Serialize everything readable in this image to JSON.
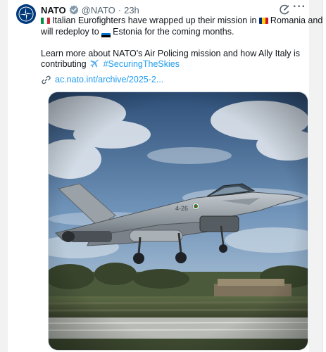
{
  "post": {
    "author_name": "NATO",
    "handle": "@NATO",
    "separator": "·",
    "time": "23h",
    "lines": [
      {
        "pre": "",
        "b": "Italian Eurofighters have wrapped up their mission in",
        "c": "Romania and"
      },
      {
        "pre": "will redeploy to",
        "b": "Estonia for the coming months.",
        "c": ""
      }
    ],
    "paragraph2_line1": "Learn more about NATO's Air Policing mission and how Ally Italy is",
    "paragraph2_line2_text": "contributing",
    "hashtag": "#SecuringTheSkies",
    "link": "ac.nato.int/archive/2025-2..."
  },
  "media": {
    "aircraft_markings": {
      "serial": "4-26",
      "roundel": "Italian roundel"
    }
  },
  "colors": {
    "accent": "#1d9bf0",
    "muted": "#536471",
    "flag_italy": [
      "#009246",
      "#ffffff",
      "#ce2b37"
    ],
    "flag_romania": [
      "#002b7f",
      "#fcd116",
      "#ce1126"
    ],
    "flag_estonia": [
      "#0072ce",
      "#000000",
      "#ffffff"
    ]
  },
  "icons": [
    "nato-compass-icon",
    "verified-badge-icon",
    "grok-icon",
    "more-icon",
    "link-icon",
    "airplane-emoji-icon"
  ]
}
